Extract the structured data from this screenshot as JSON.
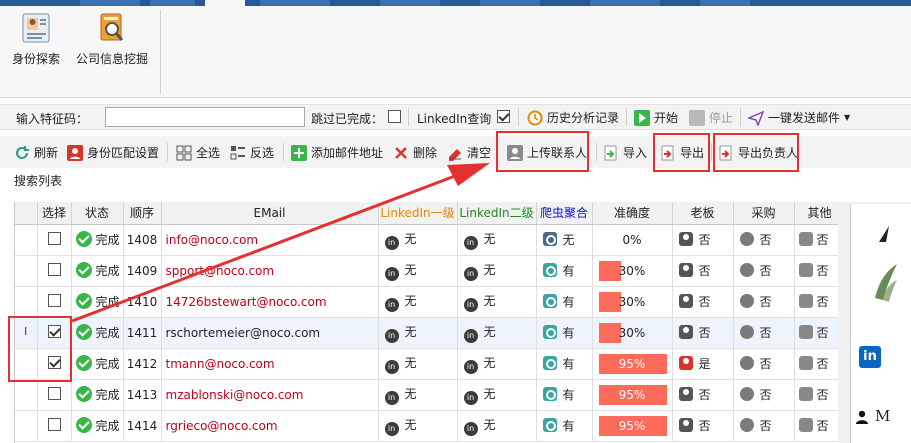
{
  "ribbon": {
    "buttons": [
      {
        "label": "身份探索",
        "icon": "id-card-icon"
      },
      {
        "label": "公司信息挖掘",
        "icon": "company-search-icon"
      }
    ]
  },
  "toolbar1": {
    "feature_label": "输入特征码：",
    "feature_value": "",
    "skip_done_label": "跳过已完成：",
    "skip_done_checked": false,
    "linkedin_query_label": "LinkedIn查询",
    "linkedin_query_checked": true,
    "history_label": "历史分析记录",
    "start_label": "开始",
    "stop_label": "停止",
    "send_mail_label": "一键发送邮件"
  },
  "toolbar2": {
    "refresh": "刷新",
    "identity_match": "身份匹配设置",
    "select_all": "全选",
    "invert": "反选",
    "add_email": "添加邮件地址",
    "delete": "删除",
    "clear": "清空",
    "upload_contacts": "上传联系人",
    "import": "导入",
    "export": "导出",
    "export_owner": "导出负责人"
  },
  "list_title": "搜索列表",
  "table": {
    "headers": [
      "选择",
      "状态",
      "顺序",
      "EMail",
      "LinkedIn一级",
      "LinkedIn二级",
      "爬虫聚合",
      "准确度",
      "老板",
      "采购",
      "其他"
    ],
    "header_colors": {
      "linkedin1": "#e08a00",
      "linkedin2": "#1e8a1e",
      "crawler": "#1010c0"
    },
    "rows": [
      {
        "checked": false,
        "status": "完成",
        "order": "1408",
        "email": "info@noco.com",
        "email_color": "red",
        "li1": "无",
        "li2": "无",
        "crawl": "无",
        "crawl_icon": "doc",
        "accuracy": 0,
        "accuracy_text": "0%",
        "boss": "否",
        "boss_red": false,
        "purchase": "否",
        "other": "否"
      },
      {
        "checked": false,
        "status": "完成",
        "order": "1409",
        "email": "spport@noco.com",
        "email_color": "red",
        "li1": "无",
        "li2": "无",
        "crawl": "有",
        "crawl_icon": "gear",
        "accuracy": 0.3,
        "accuracy_text": "30%",
        "boss": "否",
        "boss_red": false,
        "purchase": "否",
        "other": "否"
      },
      {
        "checked": false,
        "status": "完成",
        "order": "1410",
        "email": "14726bstewart@noco.com",
        "email_color": "red",
        "li1": "无",
        "li2": "无",
        "crawl": "有",
        "crawl_icon": "gear",
        "accuracy": 0.3,
        "accuracy_text": "30%",
        "boss": "否",
        "boss_red": false,
        "purchase": "否",
        "other": "否"
      },
      {
        "checked": true,
        "status": "完成",
        "order": "1411",
        "email": "rschortemeier@noco.com",
        "email_color": "dark",
        "li1": "无",
        "li2": "无",
        "crawl": "有",
        "crawl_icon": "gear",
        "accuracy": 0.3,
        "accuracy_text": "30%",
        "boss": "否",
        "boss_red": false,
        "purchase": "否",
        "other": "否"
      },
      {
        "checked": true,
        "status": "完成",
        "order": "1412",
        "email": "tmann@noco.com",
        "email_color": "red",
        "li1": "无",
        "li2": "无",
        "crawl": "有",
        "crawl_icon": "gear",
        "accuracy": 0.95,
        "accuracy_text": "95%",
        "boss": "是",
        "boss_red": true,
        "purchase": "否",
        "other": "否"
      },
      {
        "checked": false,
        "status": "完成",
        "order": "1413",
        "email": "mzablonski@noco.com",
        "email_color": "red",
        "li1": "无",
        "li2": "无",
        "crawl": "有",
        "crawl_icon": "gear",
        "accuracy": 0.95,
        "accuracy_text": "95%",
        "boss": "否",
        "boss_red": false,
        "purchase": "否",
        "other": "否"
      },
      {
        "checked": false,
        "status": "完成",
        "order": "1414",
        "email": "rgrieco@noco.com",
        "email_color": "red",
        "li1": "无",
        "li2": "无",
        "crawl": "有",
        "crawl_icon": "gear",
        "accuracy": 0.95,
        "accuracy_text": "95%",
        "boss": "否",
        "boss_red": false,
        "purchase": "否",
        "other": "否"
      }
    ]
  },
  "side_panel": {
    "text": "M"
  },
  "colors": {
    "accent_red": "#e53030",
    "accuracy_bar": "#ff6b5a",
    "status_green": "#3ab54a"
  }
}
